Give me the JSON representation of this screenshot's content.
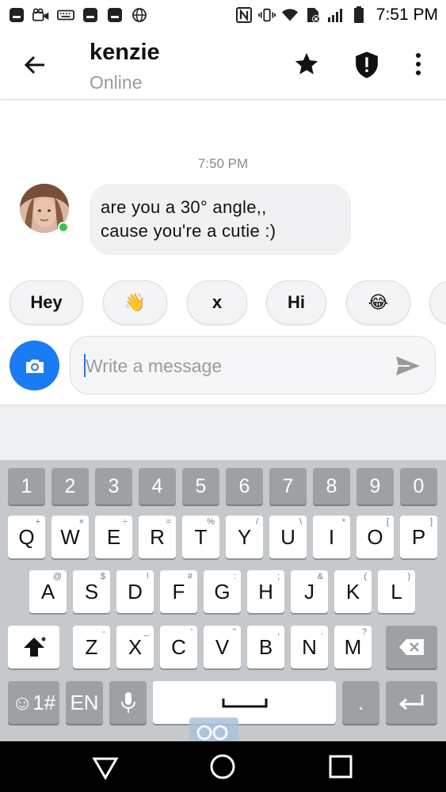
{
  "status_bar": {
    "time": "7:51 PM",
    "left_icons": [
      "messages-icon",
      "video-icon",
      "keyboard-icon",
      "messages-icon",
      "messages-icon",
      "globe-icon"
    ],
    "right_icons": [
      "nfc-icon",
      "vibrate-icon",
      "wifi-icon",
      "no-sim-icon",
      "signal-icon",
      "battery-icon"
    ]
  },
  "header": {
    "contact_name": "kenzie",
    "presence": "Online",
    "icons": [
      "back-arrow-icon",
      "star-icon",
      "shield-icon",
      "more-vertical-icon"
    ]
  },
  "chat": {
    "timestamp": "7:50 PM",
    "messages": [
      {
        "sender": "kenzie",
        "line1": "are you a 30° angle,,",
        "line2": "cause you're a cutie :)"
      }
    ]
  },
  "quick_replies": [
    "Hey",
    "👋",
    "x",
    "Hi",
    "😂"
  ],
  "composer": {
    "placeholder": "Write a message",
    "value": ""
  },
  "keyboard": {
    "number_row": [
      "1",
      "2",
      "3",
      "4",
      "5",
      "6",
      "7",
      "8",
      "9",
      "0"
    ],
    "row1": [
      {
        "k": "Q",
        "h": "+"
      },
      {
        "k": "W",
        "h": "×"
      },
      {
        "k": "E",
        "h": "÷"
      },
      {
        "k": "R",
        "h": "="
      },
      {
        "k": "T",
        "h": "%"
      },
      {
        "k": "Y",
        "h": "/"
      },
      {
        "k": "U",
        "h": "\\"
      },
      {
        "k": "I",
        "h": "*"
      },
      {
        "k": "O",
        "h": "["
      },
      {
        "k": "P",
        "h": "]"
      }
    ],
    "row2": [
      {
        "k": "A",
        "h": "@"
      },
      {
        "k": "S",
        "h": "$"
      },
      {
        "k": "D",
        "h": "!"
      },
      {
        "k": "F",
        "h": "#"
      },
      {
        "k": "G",
        "h": ":"
      },
      {
        "k": "H",
        "h": ";"
      },
      {
        "k": "J",
        "h": "&"
      },
      {
        "k": "K",
        "h": "("
      },
      {
        "k": "L",
        "h": ")"
      }
    ],
    "row3": [
      {
        "k": "Z",
        "h": "-"
      },
      {
        "k": "X",
        "h": "_"
      },
      {
        "k": "C",
        "h": "'"
      },
      {
        "k": "V",
        "h": "\""
      },
      {
        "k": "B",
        "h": ","
      },
      {
        "k": "N",
        "h": "."
      },
      {
        "k": "M",
        "h": "?"
      }
    ],
    "symbols_label": "☺1#",
    "language_label": "EN",
    "period_label": "."
  },
  "colors": {
    "accent": "#1a7bf2",
    "online": "#3bc44b",
    "bubble": "#f1f1f3",
    "keyboard_bg": "#c6c9cc"
  }
}
